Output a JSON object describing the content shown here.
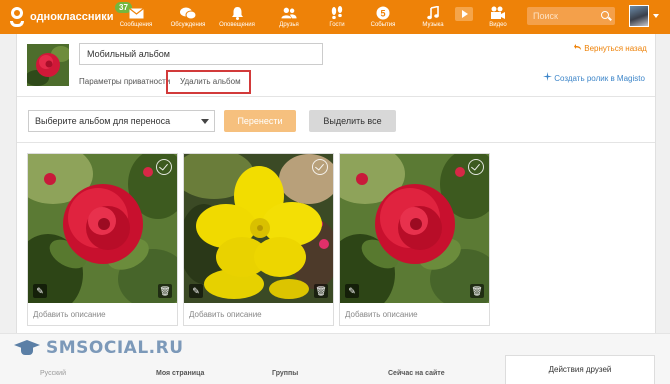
{
  "header": {
    "brand": "одноклассники",
    "messages_badge": "37",
    "nav": [
      {
        "label": "Сообщения",
        "icon": "envelope-icon"
      },
      {
        "label": "Обсуждения",
        "icon": "chat-bubbles-icon"
      },
      {
        "label": "Оповещения",
        "icon": "bell-icon"
      },
      {
        "label": "Друзья",
        "icon": "friends-icon"
      },
      {
        "label": "Гости",
        "icon": "footprints-icon"
      },
      {
        "label": "События",
        "icon": "ruble-coin-icon"
      },
      {
        "label": "Музыка",
        "icon": "music-note-icon"
      },
      {
        "label": "Видео",
        "icon": "video-camera-icon"
      }
    ],
    "search_placeholder": "Поиск"
  },
  "album": {
    "name": "Мобильный альбом",
    "privacy_link": "Параметры приватности",
    "delete_link": "Удалить альбом",
    "back_link": "Вернуться назад",
    "magisto_link": "Создать ролик в Magisto"
  },
  "toolbar": {
    "select_album": "Выберите альбом для переноса",
    "move_button": "Перенести",
    "select_all_button": "Выделить все"
  },
  "photos": [
    {
      "subject": "red-rose",
      "desc_placeholder": "Добавить описание"
    },
    {
      "subject": "yellow-flower",
      "desc_placeholder": "Добавить описание"
    },
    {
      "subject": "red-rose",
      "desc_placeholder": "Добавить описание"
    }
  ],
  "footer": {
    "watermark": "SMSOCIAL.RU",
    "language": "Русский",
    "links": [
      "Моя страница",
      "Группы",
      "Сейчас на сайте"
    ],
    "friends_activity": "Действия друзей"
  },
  "colors": {
    "brand": "#ee8208",
    "highlight": "#d23a3a",
    "link_blue": "#3e86c9"
  }
}
